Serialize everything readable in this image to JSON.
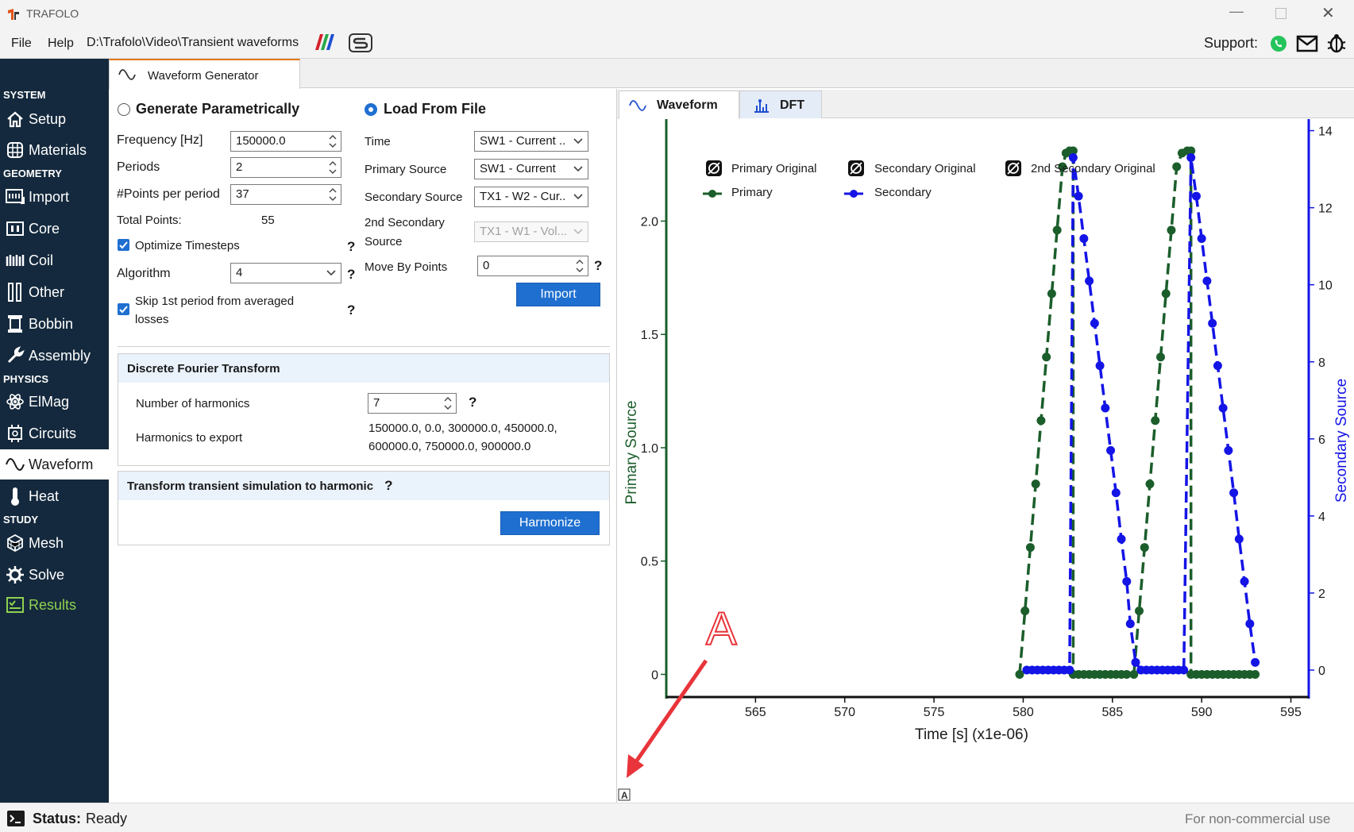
{
  "app": {
    "title": "TRAFOLO",
    "path": "D:\\Trafolo\\Video\\Transient waveforms"
  },
  "menu": {
    "file": "File",
    "help": "Help",
    "support": "Support:"
  },
  "sidebar": {
    "sections": {
      "system": "SYSTEM",
      "geometry": "GEOMETRY",
      "physics": "PHYSICS",
      "study": "STUDY"
    },
    "items": {
      "setup": "Setup",
      "materials": "Materials",
      "import": "Import",
      "core": "Core",
      "coil": "Coil",
      "other": "Other",
      "bobbin": "Bobbin",
      "assembly": "Assembly",
      "elmag": "ElMag",
      "circuits": "Circuits",
      "waveform": "Waveform",
      "heat": "Heat",
      "mesh": "Mesh",
      "solve": "Solve",
      "results": "Results"
    }
  },
  "tab": {
    "label": "Waveform Generator"
  },
  "parametric": {
    "radio_label": "Generate Parametrically",
    "frequency_label": "Frequency [Hz]",
    "frequency_value": "150000.0",
    "periods_label": "Periods",
    "periods_value": "2",
    "points_label": "#Points per period",
    "points_value": "37",
    "total_label": "Total Points:",
    "total_value": "55",
    "optimize_label": "Optimize Timesteps",
    "algorithm_label": "Algorithm",
    "algorithm_value": "4",
    "skip_label_1": "Skip 1st period from averaged",
    "skip_label_2": "losses",
    "help": "?"
  },
  "file_load": {
    "radio_label": "Load From File",
    "time_label": "Time",
    "time_value": "SW1 - Current ..",
    "primary_label": "Primary Source",
    "primary_value": "SW1 - Current",
    "secondary_label": "Secondary Source",
    "secondary_value": "TX1 - W2 - Cur..",
    "second_secondary_label_1": "2nd Secondary",
    "second_secondary_label_2": "Source",
    "second_secondary_value": "TX1 - W1 - Vol...",
    "move_label": "Move By Points",
    "move_value": "0",
    "import_button": "Import"
  },
  "dft": {
    "header": "Discrete Fourier Transform",
    "harmonics_label": "Number of harmonics",
    "harmonics_value": "7",
    "export_label": "Harmonics to export",
    "export_line1": "150000.0, 0.0, 300000.0, 450000.0,",
    "export_line2": "600000.0, 750000.0, 900000.0"
  },
  "transform": {
    "header": "Transform transient simulation to harmonic",
    "button": "Harmonize"
  },
  "plot_tabs": {
    "waveform": "Waveform",
    "dft": "DFT"
  },
  "annotation": {
    "letter": "A"
  },
  "legend": {
    "primary_original": "Primary Original",
    "secondary_original": "Secondary Original",
    "second_secondary_original": "2nd Secondary Original",
    "primary": "Primary",
    "secondary": "Secondary"
  },
  "colors": {
    "primary": "#1b5e2b",
    "secondary": "#1414e6",
    "sidebar": "#14293d",
    "accent": "#1f6fd1"
  },
  "chart_data": {
    "type": "line",
    "xlabel": "Time [s] (x1e-06)",
    "ylabel": "Primary Source",
    "y2label": "Secondary Source",
    "xlim": [
      560,
      596
    ],
    "ylim": [
      -0.1,
      2.45
    ],
    "y2lim": [
      -0.7,
      14.3
    ],
    "x_ticks": [
      565,
      570,
      575,
      580,
      585,
      590,
      595
    ],
    "y_ticks": [
      0,
      0.5,
      1.0,
      1.5,
      2.0
    ],
    "y2_ticks": [
      0,
      2,
      4,
      6,
      8,
      10,
      12,
      14
    ],
    "legend_position": "top",
    "series": [
      {
        "name": "Primary",
        "axis": "left",
        "x": [
          579.8,
          580.1,
          580.4,
          580.7,
          581.0,
          581.3,
          581.6,
          581.9,
          582.2,
          582.4,
          582.6,
          582.8,
          582.8,
          583.1,
          583.4,
          583.7,
          584.0,
          584.3,
          584.6,
          584.9,
          585.2,
          585.5,
          585.8,
          586.2,
          586.5,
          586.8,
          587.1,
          587.4,
          587.7,
          588.0,
          588.3,
          588.6,
          588.9,
          589.2,
          589.4,
          589.4,
          589.7,
          590.0,
          590.3,
          590.6,
          590.9,
          591.2,
          591.5,
          591.8,
          592.1,
          592.4,
          592.7,
          593.0
        ],
        "y": [
          0,
          0.28,
          0.56,
          0.84,
          1.12,
          1.4,
          1.68,
          1.96,
          2.24,
          2.3,
          2.31,
          2.31,
          0,
          0,
          0,
          0,
          0,
          0,
          0,
          0,
          0,
          0,
          0,
          0,
          0.28,
          0.56,
          0.84,
          1.12,
          1.4,
          1.68,
          1.96,
          2.24,
          2.3,
          2.31,
          2.31,
          0,
          0,
          0,
          0,
          0,
          0,
          0,
          0,
          0,
          0,
          0,
          0,
          0
        ]
      },
      {
        "name": "Secondary",
        "axis": "right",
        "x": [
          580.2,
          580.5,
          580.8,
          581.1,
          581.4,
          581.7,
          582.0,
          582.3,
          582.6,
          582.8,
          583.1,
          583.4,
          583.7,
          584.0,
          584.3,
          584.6,
          584.9,
          585.2,
          585.5,
          585.8,
          586.0,
          586.3,
          586.6,
          586.9,
          587.2,
          587.5,
          587.8,
          588.1,
          588.4,
          588.7,
          589.0,
          589.4,
          589.7,
          590.0,
          590.3,
          590.6,
          590.9,
          591.2,
          591.5,
          591.8,
          592.1,
          592.4,
          592.7,
          593.0
        ],
        "y": [
          0,
          0,
          0,
          0,
          0,
          0,
          0,
          0,
          0,
          13.3,
          12.3,
          11.2,
          10.1,
          9.0,
          7.9,
          6.8,
          5.7,
          4.6,
          3.4,
          2.3,
          1.2,
          0.2,
          0,
          0,
          0,
          0,
          0,
          0,
          0,
          0,
          0,
          13.3,
          12.3,
          11.2,
          10.1,
          9.0,
          7.9,
          6.8,
          5.7,
          4.6,
          3.4,
          2.3,
          1.2,
          0.2
        ]
      }
    ]
  },
  "status": {
    "label": "Status:",
    "value": "Ready",
    "right": "For non-commercial use"
  }
}
